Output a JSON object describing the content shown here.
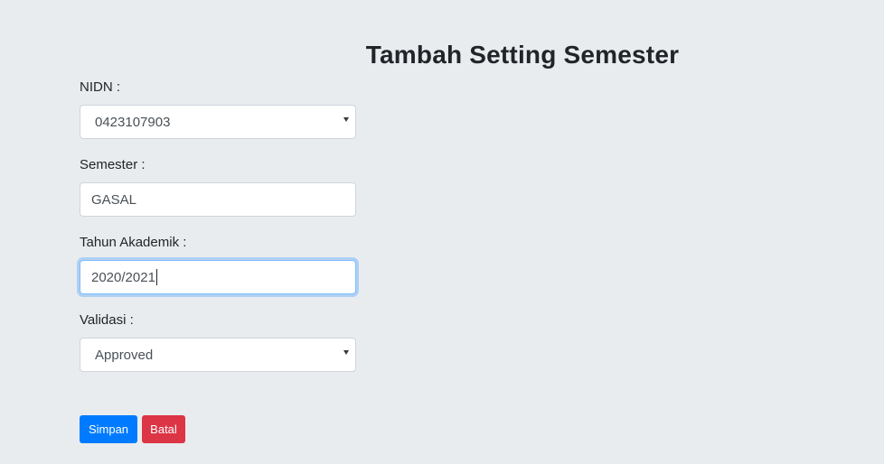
{
  "page": {
    "title": "Tambah Setting Semester"
  },
  "form": {
    "nidn": {
      "label": "NIDN :",
      "value": "0423107903"
    },
    "semester": {
      "label": "Semester :",
      "value": "GASAL"
    },
    "tahun_akademik": {
      "label": "Tahun Akademik :",
      "value": "2020/2021"
    },
    "validasi": {
      "label": "Validasi :",
      "value": "Approved"
    }
  },
  "actions": {
    "save_label": "Simpan",
    "cancel_label": "Batal"
  },
  "colors": {
    "background": "#e9ecef",
    "primary": "#007bff",
    "danger": "#dc3545",
    "focus_border": "#80bdff"
  }
}
